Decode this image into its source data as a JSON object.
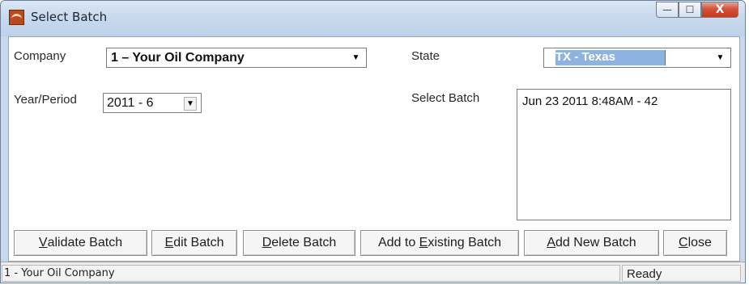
{
  "window": {
    "title": "Select Batch",
    "icon": "oil-derrick-app-icon"
  },
  "caption_buttons": {
    "minimize": "—",
    "maximize": "☐",
    "close": "X"
  },
  "form": {
    "company_label": "Company",
    "company_value": "1 – Your Oil Company",
    "state_label": "State",
    "state_value": "TX - Texas",
    "year_period_label": "Year/Period",
    "year_period_value": "2011 - 6",
    "select_batch_label": "Select Batch",
    "batches": [
      "Jun 23 2011  8:48AM - 42"
    ]
  },
  "buttons": {
    "validate_pre": "",
    "validate_key": "V",
    "validate_post": "alidate Batch",
    "edit_pre": "",
    "edit_key": "E",
    "edit_post": "dit Batch",
    "delete_pre": "",
    "delete_key": "D",
    "delete_post": "elete Batch",
    "add_existing_pre": "Add to ",
    "add_existing_key": "E",
    "add_existing_post": "xisting Batch",
    "add_new_pre": "",
    "add_new_key": "A",
    "add_new_post": "dd New Batch",
    "close_pre": "",
    "close_key": "C",
    "close_post": "lose"
  },
  "status": {
    "left": "1 - Your Oil Company",
    "right": "Ready"
  },
  "colors": {
    "state_highlight": "#8fb3e0",
    "title_gradient_top": "#dbe7f5",
    "close_button": "#c33a1f"
  }
}
